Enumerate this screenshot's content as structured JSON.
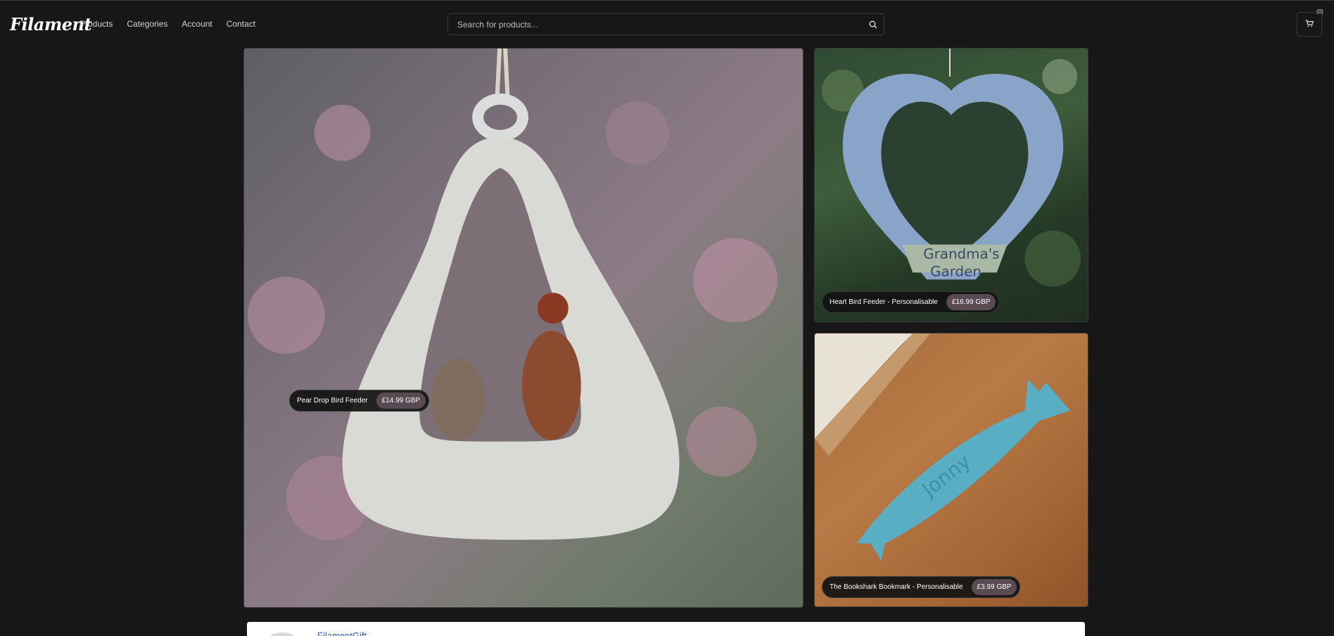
{
  "header": {
    "logo_text": "Filament",
    "nav": [
      "Products",
      "Categories",
      "Account",
      "Contact"
    ],
    "search_placeholder": "Search for products...",
    "cart_count": "(0)"
  },
  "products": [
    {
      "name": "Pear Drop Bird Feeder",
      "price": "£14.99 GBP"
    },
    {
      "name": "Heart Bird Feeder - Personalisable",
      "price": "£16.99 GBP"
    },
    {
      "name": "The Bookshark Bookmark - Personalisable",
      "price": "£3.99 GBP"
    }
  ],
  "art_text": {
    "feeder_engraving_line1": "Grandma's",
    "feeder_engraving_line2": "Garden",
    "bookmark_engraving": "Jonny"
  },
  "footer_card": {
    "store_name": "FilamentGift"
  },
  "colors": {
    "background": "#171717",
    "border": "#3a3a3a",
    "price_pill": "#5a4a52",
    "link": "#2f5ea8"
  }
}
